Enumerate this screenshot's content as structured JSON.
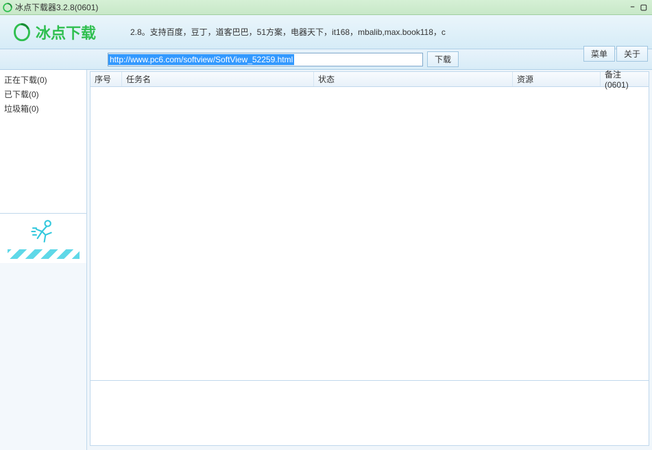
{
  "window": {
    "title": "冰点下载器3.2.8(0601)"
  },
  "header": {
    "logo_text": "冰点下载",
    "description": "2.8。支持百度，豆丁，道客巴巴，51方案，电器天下，it168，mbalib,max.book118，c",
    "menu_btn": "菜单",
    "about_btn": "关于"
  },
  "toolbar": {
    "url_value": "http://www.pc6.com/softview/SoftView_52259.html",
    "download_btn": "下载"
  },
  "sidebar": {
    "items": [
      {
        "label": "正在下载(0)"
      },
      {
        "label": "已下载(0)"
      },
      {
        "label": "垃圾箱(0)"
      }
    ]
  },
  "table": {
    "columns": {
      "seq": "序号",
      "task": "任务名",
      "status": "状态",
      "source": "资源",
      "remark": "备注(0601)"
    }
  }
}
